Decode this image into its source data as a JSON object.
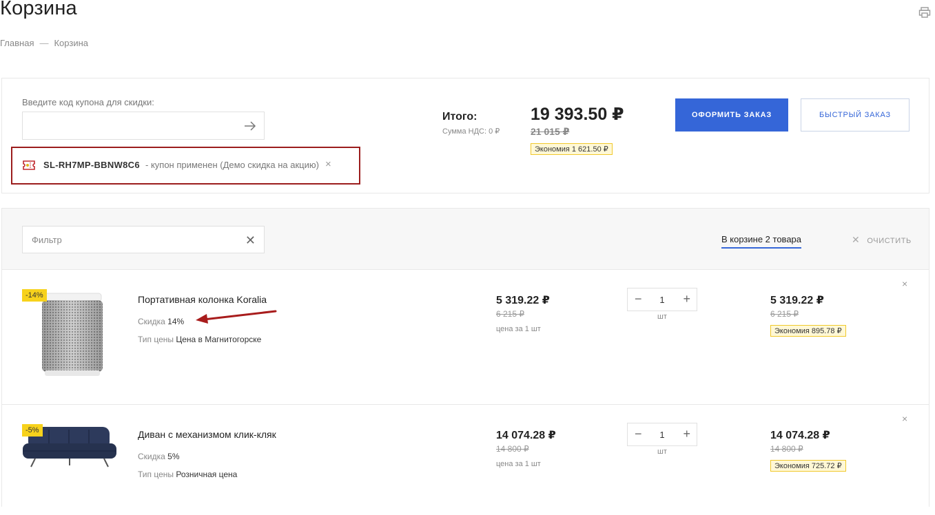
{
  "header": {
    "title": "Корзина",
    "breadcrumb": {
      "home": "Главная",
      "separator": "—",
      "current": "Корзина"
    },
    "print_icon": "printer-icon"
  },
  "coupon": {
    "label": "Введите код купона для скидки:",
    "input_value": "",
    "applied_code": "SL-RH7MP-BBNW8C6",
    "applied_status": "- купон применен (Демо скидка на акцию)",
    "close": "×"
  },
  "totals": {
    "label": "Итого:",
    "vat": "Сумма НДС: 0 ₽",
    "price": "19 393.50 ₽",
    "old_price": "21 015 ₽",
    "savings": "Экономия 1 621.50 ₽"
  },
  "buttons": {
    "order": "ОФОРМИТЬ ЗАКАЗ",
    "quick": "БЫСТРЫЙ ЗАКАЗ"
  },
  "cart": {
    "filter_placeholder": "Фильтр",
    "filter_clear": "✕",
    "count": "В корзине 2 товара",
    "clear_x": "✕",
    "clear_label": "ОЧИСТИТЬ",
    "items": [
      {
        "badge": "-14%",
        "name": "Портативная колонка Koralia",
        "discount_label": "Скидка",
        "discount_value": "14%",
        "type_label": "Тип цены",
        "type_value": "Цена в Магнитогорске",
        "price": "5 319.22 ₽",
        "old_price": "6 215 ₽",
        "price_unit": "цена за 1 шт",
        "qty": "1",
        "qty_unit": "шт",
        "sum": "5 319.22 ₽",
        "sum_old": "6 215 ₽",
        "savings": "Экономия 895.78 ₽",
        "remove": "×"
      },
      {
        "badge": "-5%",
        "name": "Диван с механизмом клик-кляк",
        "discount_label": "Скидка",
        "discount_value": "5%",
        "type_label": "Тип цены",
        "type_value": "Розничная цена",
        "price": "14 074.28 ₽",
        "old_price": "14 800 ₽",
        "price_unit": "цена за 1 шт",
        "qty": "1",
        "qty_unit": "шт",
        "sum": "14 074.28 ₽",
        "sum_old": "14 800 ₽",
        "savings": "Экономия 725.72 ₽",
        "remove": "×"
      }
    ]
  },
  "colors": {
    "accent": "#3566d8",
    "badge": "#f7d21c",
    "highlight_border": "#9b1c1c"
  }
}
